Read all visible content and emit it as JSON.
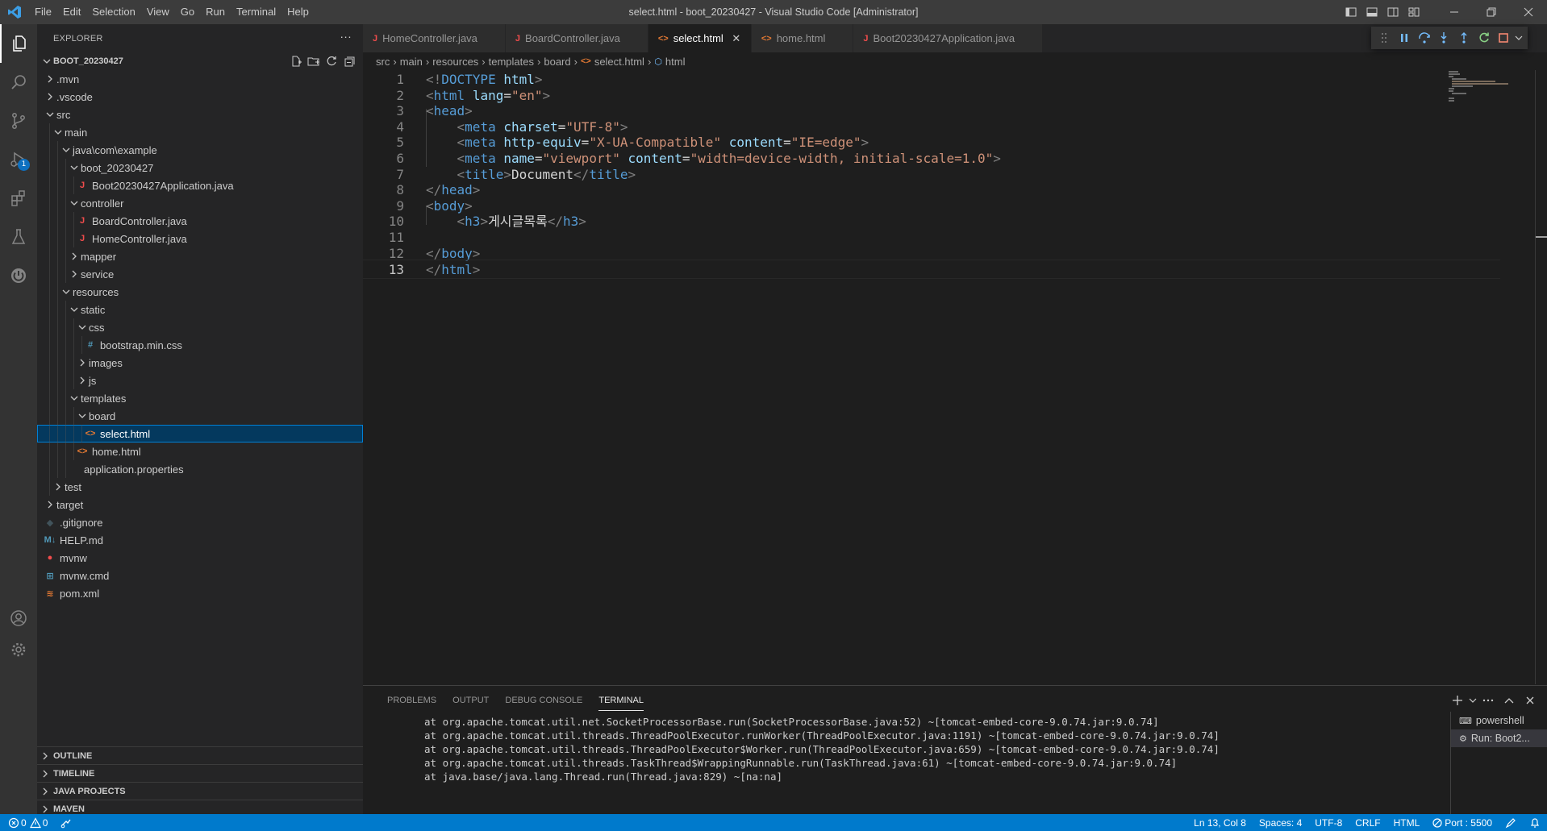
{
  "titlebar": {
    "menu": [
      "File",
      "Edit",
      "Selection",
      "View",
      "Go",
      "Run",
      "Terminal",
      "Help"
    ],
    "window_title": "select.html - boot_20230427 - Visual Studio Code [Administrator]"
  },
  "activitybar": {
    "items": [
      "explorer-icon",
      "search-icon",
      "source-control-icon",
      "run-debug-icon",
      "extensions-icon",
      "testing-icon",
      "spring-boot-icon"
    ],
    "run_badge": "1",
    "bottom": [
      "account-icon",
      "settings-gear-icon"
    ]
  },
  "sidebar": {
    "title": "EXPLORER",
    "more": "···",
    "project": "BOOT_20230427",
    "tree": [
      {
        "label": ".mvn",
        "depth": 0,
        "type": "folder",
        "open": false
      },
      {
        "label": ".vscode",
        "depth": 0,
        "type": "folder",
        "open": false
      },
      {
        "label": "src",
        "depth": 0,
        "type": "folder",
        "open": true
      },
      {
        "label": "main",
        "depth": 1,
        "type": "folder",
        "open": true
      },
      {
        "label": "java\\com\\example",
        "depth": 2,
        "type": "folder",
        "open": true
      },
      {
        "label": "boot_20230427",
        "depth": 3,
        "type": "folder",
        "open": true
      },
      {
        "label": "Boot20230427Application.java",
        "depth": 4,
        "type": "java"
      },
      {
        "label": "controller",
        "depth": 3,
        "type": "folder",
        "open": true
      },
      {
        "label": "BoardController.java",
        "depth": 4,
        "type": "java"
      },
      {
        "label": "HomeController.java",
        "depth": 4,
        "type": "java"
      },
      {
        "label": "mapper",
        "depth": 3,
        "type": "folder",
        "open": false
      },
      {
        "label": "service",
        "depth": 3,
        "type": "folder",
        "open": false
      },
      {
        "label": "resources",
        "depth": 2,
        "type": "folder",
        "open": true
      },
      {
        "label": "static",
        "depth": 3,
        "type": "folder",
        "open": true
      },
      {
        "label": "css",
        "depth": 4,
        "type": "folder",
        "open": true
      },
      {
        "label": "bootstrap.min.css",
        "depth": 5,
        "type": "css"
      },
      {
        "label": "images",
        "depth": 4,
        "type": "folder",
        "open": false
      },
      {
        "label": "js",
        "depth": 4,
        "type": "folder",
        "open": false
      },
      {
        "label": "templates",
        "depth": 3,
        "type": "folder",
        "open": true
      },
      {
        "label": "board",
        "depth": 4,
        "type": "folder",
        "open": true
      },
      {
        "label": "select.html",
        "depth": 5,
        "type": "html",
        "selected": true
      },
      {
        "label": "home.html",
        "depth": 4,
        "type": "html"
      },
      {
        "label": "application.properties",
        "depth": 3,
        "type": "props"
      },
      {
        "label": "test",
        "depth": 1,
        "type": "folder",
        "open": false
      },
      {
        "label": "target",
        "depth": 0,
        "type": "folder",
        "open": false
      },
      {
        "label": ".gitignore",
        "depth": 0,
        "type": "git"
      },
      {
        "label": "HELP.md",
        "depth": 0,
        "type": "md"
      },
      {
        "label": "mvnw",
        "depth": 0,
        "type": "mvnw"
      },
      {
        "label": "mvnw.cmd",
        "depth": 0,
        "type": "cmd"
      },
      {
        "label": "pom.xml",
        "depth": 0,
        "type": "xml"
      }
    ],
    "sections": [
      "OUTLINE",
      "TIMELINE",
      "JAVA PROJECTS",
      "MAVEN"
    ]
  },
  "tabs": [
    {
      "label": "HomeController.java",
      "type": "java",
      "active": false
    },
    {
      "label": "BoardController.java",
      "type": "java",
      "active": false
    },
    {
      "label": "select.html",
      "type": "html",
      "active": true
    },
    {
      "label": "home.html",
      "type": "html",
      "active": false
    },
    {
      "label": "Boot20230427Application.java",
      "type": "java",
      "active": false
    }
  ],
  "breadcrumb": [
    "src",
    "main",
    "resources",
    "templates",
    "board",
    "select.html",
    "html"
  ],
  "editor": {
    "current_line": 13,
    "lines": [
      [
        [
          "br",
          "<!"
        ],
        [
          "tag",
          "DOCTYPE"
        ],
        [
          "txt",
          " "
        ],
        [
          "attr",
          "html"
        ],
        [
          "br",
          ">"
        ]
      ],
      [
        [
          "br",
          "<"
        ],
        [
          "tag",
          "html"
        ],
        [
          "txt",
          " "
        ],
        [
          "attr",
          "lang"
        ],
        [
          "txt",
          "="
        ],
        [
          "val",
          "\"en\""
        ],
        [
          "br",
          ">"
        ]
      ],
      [
        [
          "br",
          "<"
        ],
        [
          "tag",
          "head"
        ],
        [
          "br",
          ">"
        ]
      ],
      [
        [
          "txt",
          "    "
        ],
        [
          "br",
          "<"
        ],
        [
          "tag",
          "meta"
        ],
        [
          "txt",
          " "
        ],
        [
          "attr",
          "charset"
        ],
        [
          "txt",
          "="
        ],
        [
          "val",
          "\"UTF-8\""
        ],
        [
          "br",
          ">"
        ]
      ],
      [
        [
          "txt",
          "    "
        ],
        [
          "br",
          "<"
        ],
        [
          "tag",
          "meta"
        ],
        [
          "txt",
          " "
        ],
        [
          "attr",
          "http-equiv"
        ],
        [
          "txt",
          "="
        ],
        [
          "val",
          "\"X-UA-Compatible\""
        ],
        [
          "txt",
          " "
        ],
        [
          "attr",
          "content"
        ],
        [
          "txt",
          "="
        ],
        [
          "val",
          "\"IE=edge\""
        ],
        [
          "br",
          ">"
        ]
      ],
      [
        [
          "txt",
          "    "
        ],
        [
          "br",
          "<"
        ],
        [
          "tag",
          "meta"
        ],
        [
          "txt",
          " "
        ],
        [
          "attr",
          "name"
        ],
        [
          "txt",
          "="
        ],
        [
          "val",
          "\"viewport\""
        ],
        [
          "txt",
          " "
        ],
        [
          "attr",
          "content"
        ],
        [
          "txt",
          "="
        ],
        [
          "val",
          "\"width=device-width, initial-scale=1.0\""
        ],
        [
          "br",
          ">"
        ]
      ],
      [
        [
          "txt",
          "    "
        ],
        [
          "br",
          "<"
        ],
        [
          "tag",
          "title"
        ],
        [
          "br",
          ">"
        ],
        [
          "txt",
          "Document"
        ],
        [
          "br",
          "</"
        ],
        [
          "tag",
          "title"
        ],
        [
          "br",
          ">"
        ]
      ],
      [
        [
          "br",
          "</"
        ],
        [
          "tag",
          "head"
        ],
        [
          "br",
          ">"
        ]
      ],
      [
        [
          "br",
          "<"
        ],
        [
          "tag",
          "body"
        ],
        [
          "br",
          ">"
        ]
      ],
      [
        [
          "txt",
          "    "
        ],
        [
          "br",
          "<"
        ],
        [
          "tag",
          "h3"
        ],
        [
          "br",
          ">"
        ],
        [
          "txt",
          "게시글목록"
        ],
        [
          "br",
          "</"
        ],
        [
          "tag",
          "h3"
        ],
        [
          "br",
          ">"
        ]
      ],
      [
        [
          "txt",
          ""
        ]
      ],
      [
        [
          "br",
          "</"
        ],
        [
          "tag",
          "body"
        ],
        [
          "br",
          ">"
        ]
      ],
      [
        [
          "br",
          "</"
        ],
        [
          "tag",
          "html"
        ],
        [
          "br",
          ">"
        ]
      ]
    ]
  },
  "panel": {
    "tabs": [
      "PROBLEMS",
      "OUTPUT",
      "DEBUG CONSOLE",
      "TERMINAL"
    ],
    "active_tab": "TERMINAL",
    "terminal_lines": [
      "at org.apache.tomcat.util.net.SocketProcessorBase.run(SocketProcessorBase.java:52) ~[tomcat-embed-core-9.0.74.jar:9.0.74]",
      "at org.apache.tomcat.util.threads.ThreadPoolExecutor.runWorker(ThreadPoolExecutor.java:1191) ~[tomcat-embed-core-9.0.74.jar:9.0.74]",
      "at org.apache.tomcat.util.threads.ThreadPoolExecutor$Worker.run(ThreadPoolExecutor.java:659) ~[tomcat-embed-core-9.0.74.jar:9.0.74]",
      "at org.apache.tomcat.util.threads.TaskThread$WrappingRunnable.run(TaskThread.java:61) ~[tomcat-embed-core-9.0.74.jar:9.0.74]",
      "at java.base/java.lang.Thread.run(Thread.java:829) ~[na:na]"
    ],
    "terminals": [
      {
        "label": "powershell",
        "active": false
      },
      {
        "label": "Run: Boot2...",
        "active": true
      }
    ]
  },
  "statusbar": {
    "errors": "0",
    "warnings": "0",
    "position": "Ln 13, Col 8",
    "spaces": "Spaces: 4",
    "encoding": "UTF-8",
    "eol": "CRLF",
    "language": "HTML",
    "port": "Port : 5500"
  },
  "colors": {
    "accent": "#007acc",
    "java_icon": "#f14c4c",
    "html_icon": "#e37933",
    "css_icon": "#519aba",
    "selection": "#04395e"
  }
}
